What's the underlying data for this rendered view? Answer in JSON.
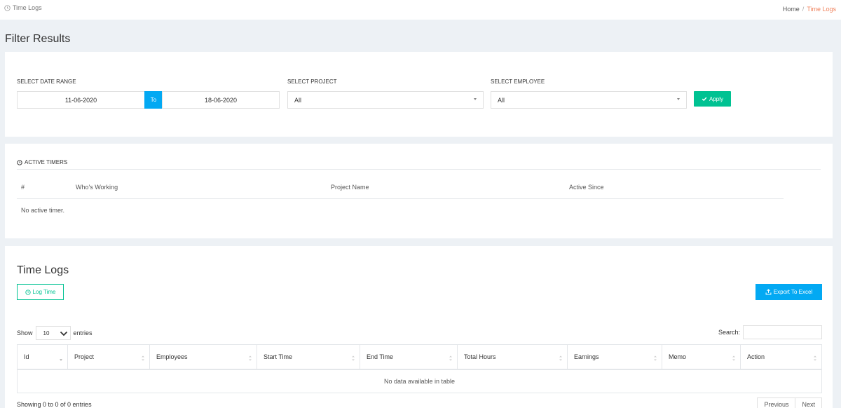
{
  "header": {
    "page_title": "Time Logs",
    "breadcrumb": {
      "home": "Home",
      "separator": "/",
      "current": "Time Logs"
    }
  },
  "filter": {
    "heading": "Filter Results",
    "date_range_label": "SELECT DATE RANGE",
    "start_date": "11-06-2020",
    "to_label": "To",
    "end_date": "18-06-2020",
    "project_label": "SELECT PROJECT",
    "project_value": "All",
    "employee_label": "SELECT EMPLOYEE",
    "employee_value": "All",
    "apply_label": "Apply"
  },
  "active_timers": {
    "title": "ACTIVE TIMERS",
    "columns": [
      "#",
      "Who's Working",
      "Project Name",
      "Active Since"
    ],
    "empty_text": "No active timer."
  },
  "time_logs": {
    "title": "Time Logs",
    "log_time_label": "Log Time",
    "export_label": "Export To Excel",
    "show_label": "Show",
    "page_length": "10",
    "entries_label": "entries",
    "search_label": "Search:",
    "columns": [
      "Id",
      "Project",
      "Employees",
      "Start Time",
      "End Time",
      "Total Hours",
      "Earnings",
      "Memo",
      "Action"
    ],
    "empty_text": "No data available in table",
    "info_text": "Showing 0 to 0 of 0 entries",
    "previous_label": "Previous",
    "next_label": "Next"
  },
  "colors": {
    "accent_orange": "#f0835e",
    "success_green": "#00c292",
    "info_blue": "#03a9f3",
    "page_bg": "#edf1f5"
  },
  "icons": [
    "clock-icon",
    "check-icon",
    "upload-icon",
    "chevron-down-icon",
    "sort-icon"
  ]
}
